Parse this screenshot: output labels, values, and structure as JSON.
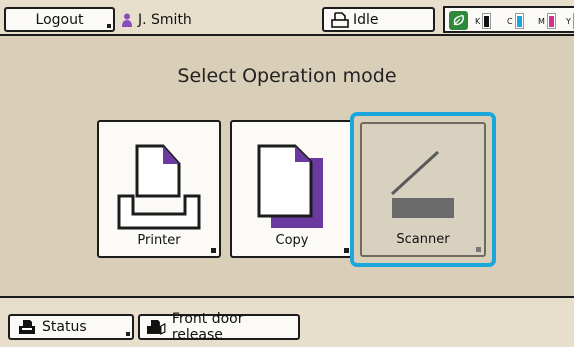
{
  "topbar": {
    "logout_label": "Logout",
    "user_name": "J. Smith",
    "printer_status": "Idle",
    "ink": [
      {
        "label": "K",
        "color": "#111111",
        "level": 0.9
      },
      {
        "label": "C",
        "color": "#1ba7dc",
        "level": 0.9
      },
      {
        "label": "M",
        "color": "#d6308c",
        "level": 0.9
      },
      {
        "label": "Y",
        "color": "#f2c500",
        "level": 0.9
      }
    ]
  },
  "main": {
    "title": "Select Operation mode",
    "modes": [
      {
        "label": "Printer",
        "icon": "printer-icon"
      },
      {
        "label": "Copy",
        "icon": "copy-icon"
      },
      {
        "label": "Scanner",
        "icon": "scanner-icon",
        "selected": true
      }
    ]
  },
  "bottombar": {
    "status_label": "Status",
    "front_door_label": "Front door release"
  },
  "colors": {
    "background": "#d9cfb8",
    "accent_selection": "#1ba7dc",
    "copy_purple": "#6b3aa0",
    "user_icon_purple": "#8a4bbf",
    "ink_ok_green": "#2e8a3a"
  }
}
